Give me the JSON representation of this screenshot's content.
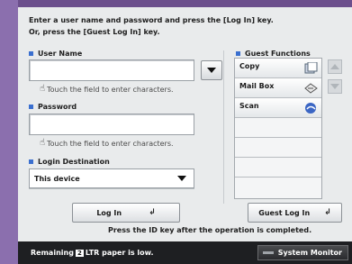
{
  "instructions": {
    "line1": "Enter a user name and password and press the [Log In] key.",
    "line2": "Or, press the [Guest Log In] key."
  },
  "user_name": {
    "label": "User Name",
    "value": "",
    "hint": "Touch the field to enter characters."
  },
  "password": {
    "label": "Password",
    "value": "",
    "hint": "Touch the field to enter characters."
  },
  "login_destination": {
    "label": "Login Destination",
    "selected": "This device"
  },
  "guest_functions": {
    "label": "Guest Functions",
    "items": [
      {
        "label": "Copy",
        "icon": "copy-icon"
      },
      {
        "label": "Mail Box",
        "icon": "mailbox-icon"
      },
      {
        "label": "Scan",
        "icon": "scan-icon"
      }
    ]
  },
  "buttons": {
    "log_in": "Log In",
    "guest_log_in": "Guest Log In"
  },
  "bottom_message": "Press the ID key after the operation is completed.",
  "status_bar": {
    "remaining_prefix": "Remaining",
    "paper_badge": "2",
    "remaining_suffix": "LTR paper is low.",
    "system_monitor": "System Monitor"
  },
  "colors": {
    "accent_bullet": "#3a6fcf",
    "frame_purple": "#7a5a9a",
    "status_bar": "#1e1f22"
  }
}
